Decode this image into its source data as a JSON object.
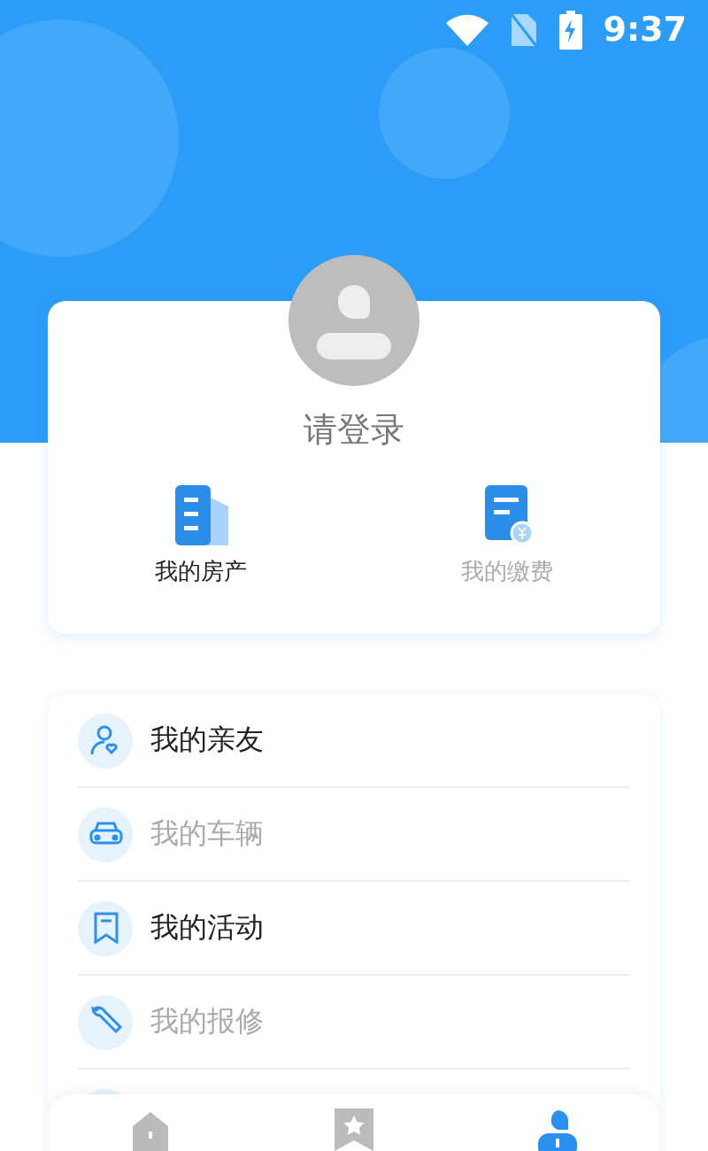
{
  "status_bar": {
    "time": "9:37"
  },
  "profile": {
    "login_prompt": "请登录"
  },
  "shortcuts": [
    {
      "label": "我的房产",
      "kind": "property",
      "disabled": false
    },
    {
      "label": "我的缴费",
      "kind": "payment",
      "disabled": true
    }
  ],
  "menu": [
    {
      "label": "我的亲友",
      "kind": "friends",
      "disabled": false
    },
    {
      "label": "我的车辆",
      "kind": "car",
      "disabled": true
    },
    {
      "label": "我的活动",
      "kind": "activity",
      "disabled": false
    },
    {
      "label": "我的报修",
      "kind": "repair",
      "disabled": true
    }
  ],
  "tab_bar": [
    {
      "kind": "home",
      "selected": false
    },
    {
      "kind": "favorites",
      "selected": false
    },
    {
      "kind": "profile",
      "selected": true
    }
  ]
}
